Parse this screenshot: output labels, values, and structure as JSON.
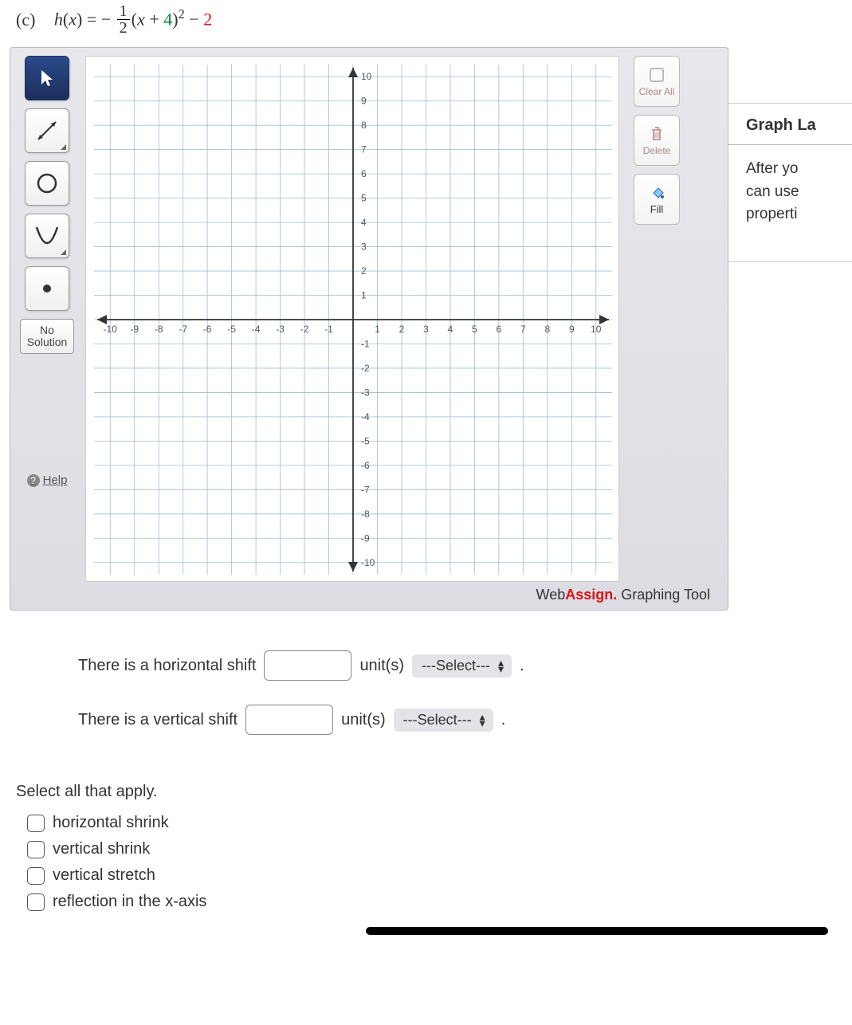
{
  "equation": {
    "part_label": "(c)",
    "fn": "h",
    "arg": "x",
    "prefix": "− ",
    "frac_num": "1",
    "frac_den": "2",
    "open": "(",
    "var": "x",
    "plus": " + ",
    "shift_h": "4",
    "close_sq": ")",
    "exp": "2",
    "minus": " − ",
    "shift_v": "2"
  },
  "graph": {
    "x_ticks": [
      "-10",
      "-9",
      "-8",
      "-7",
      "-6",
      "-5",
      "-4",
      "-3",
      "-2",
      "-1",
      "1",
      "2",
      "3",
      "4",
      "5",
      "6",
      "7",
      "8",
      "9",
      "10"
    ],
    "y_ticks_pos": [
      "10",
      "9",
      "8",
      "7",
      "6",
      "5",
      "4",
      "3",
      "2",
      "1"
    ],
    "y_ticks_neg": [
      "-1",
      "-2",
      "-3",
      "-4",
      "-5",
      "-6",
      "-7",
      "-8",
      "-9",
      "-10"
    ],
    "tools": {
      "select": "select-tool",
      "line": "line-tool",
      "circle": "circle-tool",
      "parabola": "parabola-tool",
      "point": "point-tool",
      "no_solution_line1": "No",
      "no_solution_line2": "Solution"
    },
    "right_tools": {
      "clear": "Clear All",
      "delete": "Delete",
      "fill": "Fill"
    },
    "help": "Help",
    "brand_pre": "Web",
    "brand_bold": "Assign.",
    "brand_suffix": " Graphing Tool"
  },
  "side_panel": {
    "title": "Graph La",
    "line1": "After yo",
    "line2": "can use",
    "line3": "properti"
  },
  "questions": {
    "h_shift_label": "There is a horizontal shift",
    "v_shift_label": "There is a vertical shift",
    "unit_label": "unit(s)",
    "select_placeholder": "---Select---",
    "period": "."
  },
  "select_all": {
    "prompt": "Select all that apply.",
    "options": [
      "horizontal shrink",
      "vertical shrink",
      "vertical stretch",
      "reflection in the x-axis"
    ]
  },
  "chart_data": {
    "type": "scatter",
    "title": "",
    "xlabel": "",
    "ylabel": "",
    "xlim": [
      -10,
      10
    ],
    "ylim": [
      -10,
      10
    ],
    "x_ticks": [
      -10,
      -9,
      -8,
      -7,
      -6,
      -5,
      -4,
      -3,
      -2,
      -1,
      1,
      2,
      3,
      4,
      5,
      6,
      7,
      8,
      9,
      10
    ],
    "y_ticks": [
      -10,
      -9,
      -8,
      -7,
      -6,
      -5,
      -4,
      -3,
      -2,
      -1,
      1,
      2,
      3,
      4,
      5,
      6,
      7,
      8,
      9,
      10
    ],
    "series": []
  }
}
